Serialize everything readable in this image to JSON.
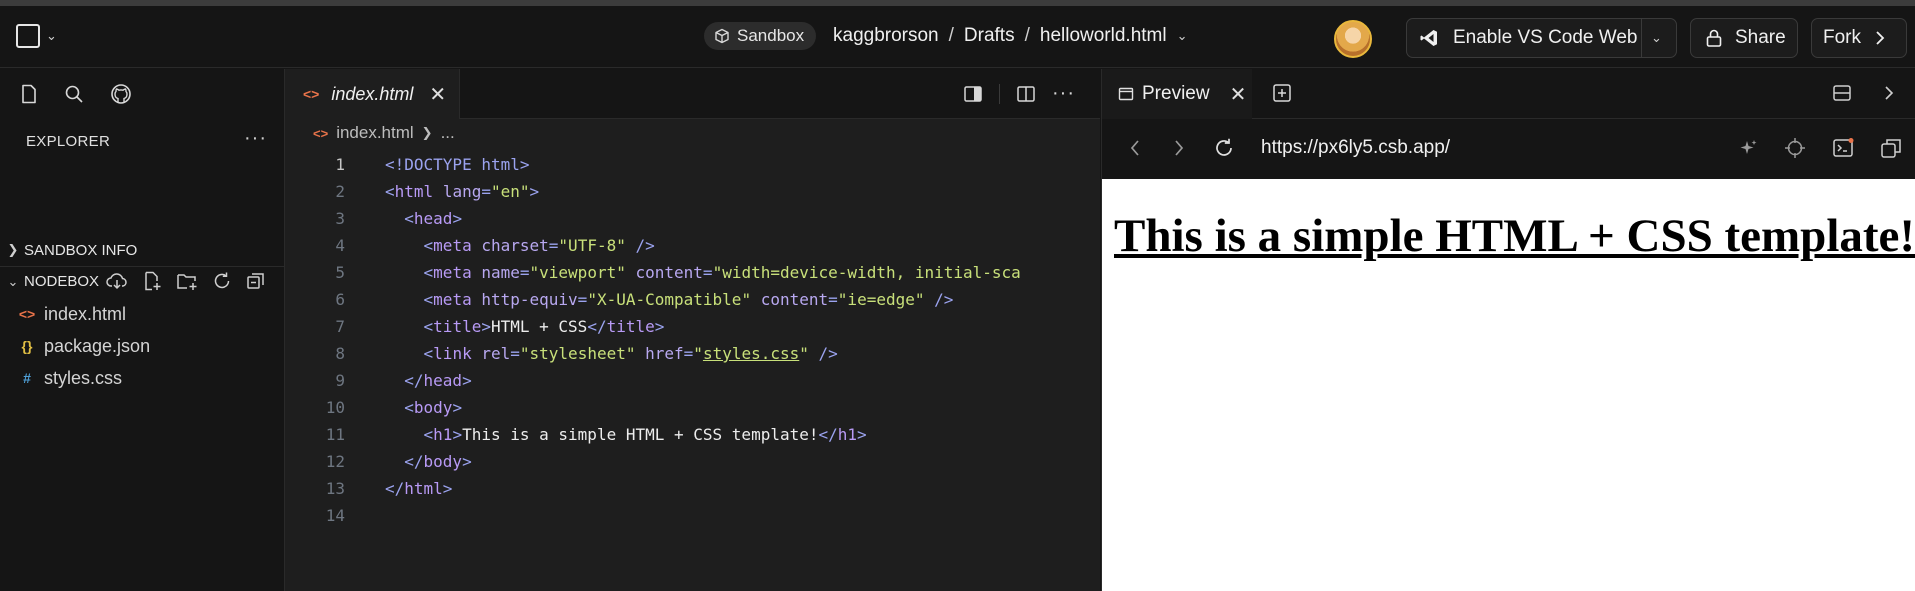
{
  "header": {
    "sandbox_label": "Sandbox",
    "breadcrumb": [
      "kaggbrorson",
      "Drafts",
      "helloworld.html"
    ],
    "separator": "/",
    "vscode_label": "Enable VS Code Web",
    "share_label": "Share",
    "fork_label": "Fork"
  },
  "sidebar": {
    "title": "EXPLORER",
    "more": "···",
    "sections": [
      "SANDBOX INFO",
      "NODEBOX"
    ],
    "files": [
      {
        "name": "index.html",
        "icon": "html-file-icon",
        "color": "#e8734a",
        "glyph": "<>"
      },
      {
        "name": "package.json",
        "icon": "json-file-icon",
        "color": "#e2c044",
        "glyph": "{}"
      },
      {
        "name": "styles.css",
        "icon": "css-file-icon",
        "color": "#4e9fd6",
        "glyph": "#"
      }
    ]
  },
  "editor": {
    "tab_name": "index.html",
    "breadcrumb_file": "index.html",
    "breadcrumb_rest": "...",
    "line_numbers": [
      "1",
      "2",
      "3",
      "4",
      "5",
      "6",
      "7",
      "8",
      "9",
      "10",
      "11",
      "12",
      "13",
      "14"
    ],
    "code": {
      "l1": "<!DOCTYPE html>",
      "l2_tag": "html",
      "l2_attr": "lang",
      "l2_val": "\"en\"",
      "l3_tag": "head",
      "l4_attr": "charset",
      "l4_val": "\"UTF-8\"",
      "l5_attr1": "name",
      "l5_val1": "\"viewport\"",
      "l5_attr2": "content",
      "l5_val2": "\"width=device-width, initial-sca",
      "l6_attr1": "http-equiv",
      "l6_val1": "\"X-UA-Compatible\"",
      "l6_attr2": "content",
      "l6_val2": "\"ie=edge\"",
      "l7_text": "HTML + CSS",
      "l8_attr1": "rel",
      "l8_val1": "\"stylesheet\"",
      "l8_attr2": "href",
      "l8_val2_q": "\"",
      "l8_val2": "styles.css",
      "l11_text": "This is a simple HTML + CSS template!"
    }
  },
  "preview": {
    "tab_label": "Preview",
    "url": "https://px6ly5.csb.app/",
    "heading": "This is a simple HTML + CSS template!"
  },
  "colors": {
    "accent_orange": "#e8734a",
    "background": "#151515",
    "editor_bg": "#1e1e1e"
  }
}
